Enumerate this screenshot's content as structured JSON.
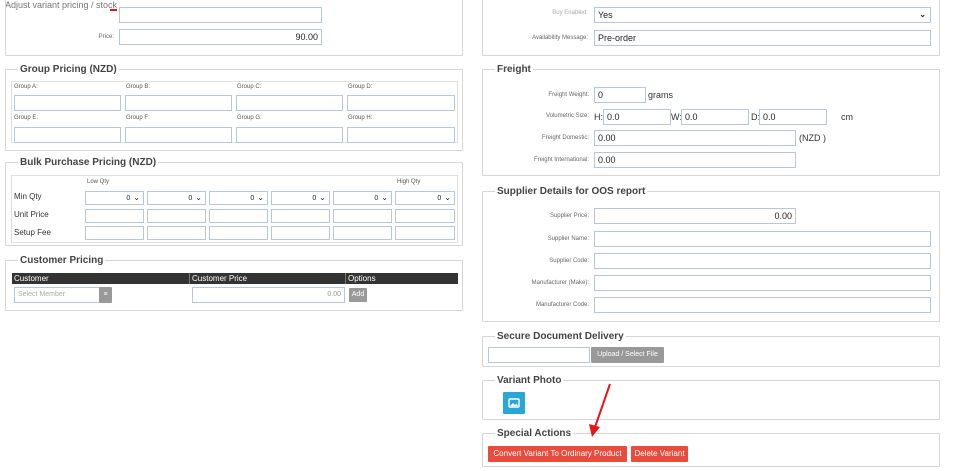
{
  "page_title": "Adjust variant pricing / stock",
  "price": {
    "label": "Price:",
    "value": "90.00"
  },
  "group_pricing": {
    "title": "Group Pricing (NZD)",
    "groups": [
      "Group A:",
      "Group B:",
      "Group C:",
      "Group D:",
      "Group E:",
      "Group F:",
      "Group G:",
      "Group H:"
    ]
  },
  "bulk_pricing": {
    "title": "Bulk Purchase Pricing (NZD)",
    "low_qty": "Low Qty",
    "high_qty": "High Qty",
    "rows": [
      "Min Qty",
      "Unit Price",
      "Setup Fee"
    ],
    "min_qty_value": "0"
  },
  "customer_pricing": {
    "title": "Customer Pricing",
    "headers": [
      "Customer",
      "Customer Price",
      "Options"
    ],
    "member_placeholder": "Select Member",
    "price_value": "0.00",
    "add_label": "Add"
  },
  "availability": {
    "buy_enabled_label": "Buy Enabled:",
    "buy_enabled_value": "Yes",
    "message_label": "Availability Message:",
    "message_value": "Pre-order"
  },
  "freight": {
    "title": "Freight",
    "weight_label": "Freight Weight:",
    "weight_value": "0",
    "weight_unit": "grams",
    "volumetric_label": "Volumetric Size:",
    "h_label": "H:",
    "h_value": "0.0",
    "w_label": "W:",
    "w_value": "0.0",
    "d_label": "D:",
    "d_value": "0.0",
    "vol_unit": "cm",
    "domestic_label": "Freight Domestic:",
    "domestic_value": "0.00",
    "domestic_unit": "(NZD )",
    "international_label": "Freight International:",
    "international_value": "0.00"
  },
  "supplier": {
    "title": "Supplier Details for OOS report",
    "price_label": "Supplier Price:",
    "price_value": "0.00",
    "name_label": "Supplier Name:",
    "code_label": "Supplier Code:",
    "make_label": "Manufacturer (Make):",
    "mcode_label": "Manufacturer Code:"
  },
  "secure_doc": {
    "title": "Secure Document Delivery",
    "upload_label": "Upload / Select File"
  },
  "variant_photo": {
    "title": "Variant Photo"
  },
  "special_actions": {
    "title": "Special Actions",
    "convert_label": "Convert Variant To Ordinary Product",
    "delete_label": "Delete Variant"
  },
  "colors": {
    "accent_red": "#e74c3c",
    "photo_blue": "#29a8d8",
    "annotation_arrow": "#e8141b"
  }
}
